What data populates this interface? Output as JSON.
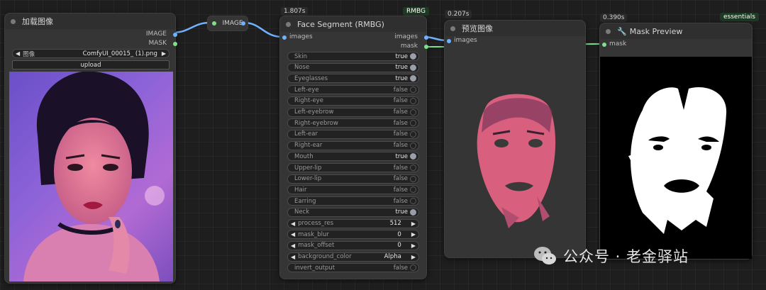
{
  "load_node": {
    "title": "加载图像",
    "out_image": "IMAGE",
    "out_mask": "MASK",
    "image_label": "图像",
    "image_value": "ComfyUI_00015_ (1).png",
    "upload_label": "upload"
  },
  "reroute": {
    "label": "IMAGE"
  },
  "face_node": {
    "time": "1.807s",
    "badge": "RMBG",
    "title": "Face Segment (RMBG)",
    "in_images": "images",
    "out_images": "images",
    "out_mask": "mask",
    "toggles": [
      {
        "label": "Skin",
        "value": "true"
      },
      {
        "label": "Nose",
        "value": "true"
      },
      {
        "label": "Eyeglasses",
        "value": "true"
      },
      {
        "label": "Left-eye",
        "value": "false"
      },
      {
        "label": "Right-eye",
        "value": "false"
      },
      {
        "label": "Left-eyebrow",
        "value": "false"
      },
      {
        "label": "Right-eyebrow",
        "value": "false"
      },
      {
        "label": "Left-ear",
        "value": "false"
      },
      {
        "label": "Right-ear",
        "value": "false"
      },
      {
        "label": "Mouth",
        "value": "true"
      },
      {
        "label": "Upper-lip",
        "value": "false"
      },
      {
        "label": "Lower-lip",
        "value": "false"
      },
      {
        "label": "Hair",
        "value": "false"
      },
      {
        "label": "Earring",
        "value": "false"
      },
      {
        "label": "Neck",
        "value": "true"
      }
    ],
    "numbers": [
      {
        "label": "process_res",
        "value": "512"
      },
      {
        "label": "mask_blur",
        "value": "0"
      },
      {
        "label": "mask_offset",
        "value": "0"
      },
      {
        "label": "background_color",
        "value": "Alpha"
      }
    ],
    "invert": {
      "label": "invert_output",
      "value": "false"
    }
  },
  "preview_node": {
    "time": "0.207s",
    "title": "预览图像",
    "in_images": "images"
  },
  "mask_node": {
    "time": "0.390s",
    "badge": "essentials",
    "title": "Mask Preview",
    "in_mask": "mask"
  },
  "watermark": {
    "text": "公众号 · 老金驿站"
  },
  "colors": {
    "link_blue": "#6fb2ff",
    "link_green": "#7fe08e",
    "canvas": "#1e1e1e"
  },
  "icons": {
    "wechat": "wechat-icon",
    "wrench": "wrench-icon"
  }
}
